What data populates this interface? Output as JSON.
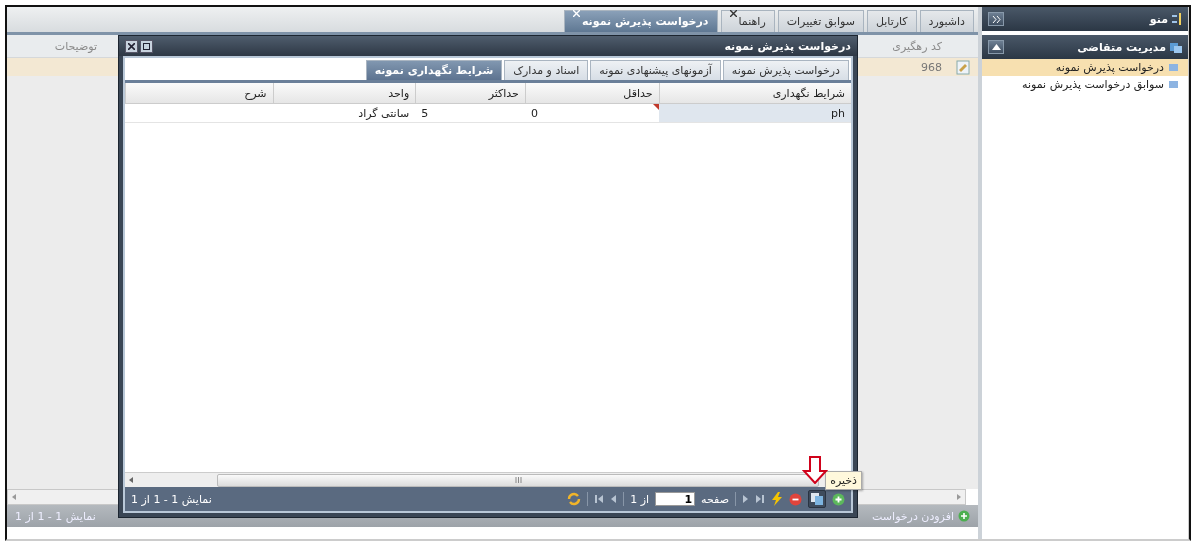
{
  "sidebar": {
    "title": "منو",
    "section": "مدیریت متقاضی",
    "items": [
      {
        "label": "درخواست پذیرش نمونه",
        "selected": true
      },
      {
        "label": "سوابق درخواست پذیرش نمونه",
        "selected": false
      }
    ]
  },
  "tabs": [
    {
      "label": "داشبورد",
      "selected": false,
      "closable": false
    },
    {
      "label": "کارتابل",
      "selected": false,
      "closable": false
    },
    {
      "label": "سوابق تغییرات",
      "selected": false,
      "closable": false
    },
    {
      "label": "راهنما",
      "selected": false,
      "closable": true
    },
    {
      "label": "درخواست پذیرش نمونه",
      "selected": true,
      "closable": true
    }
  ],
  "grid": {
    "columns": [
      "کد رهگیری",
      "توضیحات"
    ],
    "rows": [
      {
        "tracking_code": "968",
        "selected": true
      }
    ]
  },
  "toolbar": {
    "add_label": "افزودن درخواست",
    "summary": "نمایش 1 - 1 از 1"
  },
  "dialog": {
    "title": "درخواست پذیرش نمونه",
    "tabs": [
      {
        "label": "درخواست پذیرش نمونه",
        "selected": false
      },
      {
        "label": "آزمونهای پیشنهادی نمونه",
        "selected": false
      },
      {
        "label": "اسناد و مدارک",
        "selected": false
      },
      {
        "label": "شرایط نگهداری نمونه",
        "selected": true
      }
    ],
    "columns": [
      "شرایط نگهداری",
      "حداقل",
      "حداکثر",
      "واحد",
      "شرح"
    ],
    "rows": [
      {
        "cells": [
          {
            "text": "ph",
            "selected": true,
            "dirty": false
          },
          {
            "text": "0",
            "selected": false,
            "dirty": true
          },
          {
            "text": "5",
            "selected": false,
            "dirty": false
          },
          {
            "text": "سانتی گراد",
            "selected": false,
            "dirty": false
          }
        ]
      }
    ],
    "pager": {
      "page_label": "صفحه",
      "page": "1",
      "of_label": "از 1",
      "summary": "نمایش 1 - 1 از 1",
      "tooltip": "ذخیره"
    }
  }
}
